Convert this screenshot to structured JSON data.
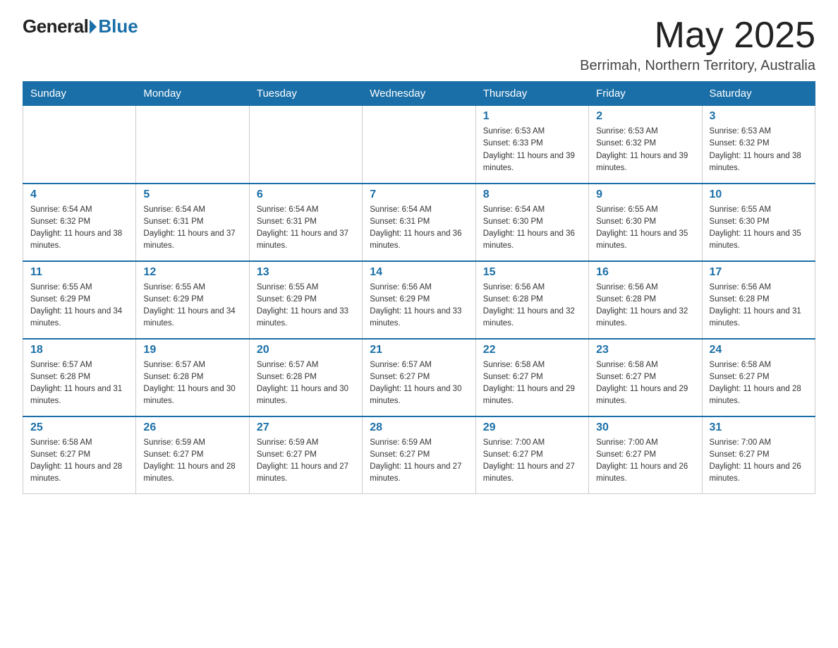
{
  "header": {
    "logo_general": "General",
    "logo_blue": "Blue",
    "month_year": "May 2025",
    "location": "Berrimah, Northern Territory, Australia"
  },
  "days_of_week": [
    "Sunday",
    "Monday",
    "Tuesday",
    "Wednesday",
    "Thursday",
    "Friday",
    "Saturday"
  ],
  "weeks": [
    [
      {
        "day": "",
        "info": ""
      },
      {
        "day": "",
        "info": ""
      },
      {
        "day": "",
        "info": ""
      },
      {
        "day": "",
        "info": ""
      },
      {
        "day": "1",
        "info": "Sunrise: 6:53 AM\nSunset: 6:33 PM\nDaylight: 11 hours and 39 minutes."
      },
      {
        "day": "2",
        "info": "Sunrise: 6:53 AM\nSunset: 6:32 PM\nDaylight: 11 hours and 39 minutes."
      },
      {
        "day": "3",
        "info": "Sunrise: 6:53 AM\nSunset: 6:32 PM\nDaylight: 11 hours and 38 minutes."
      }
    ],
    [
      {
        "day": "4",
        "info": "Sunrise: 6:54 AM\nSunset: 6:32 PM\nDaylight: 11 hours and 38 minutes."
      },
      {
        "day": "5",
        "info": "Sunrise: 6:54 AM\nSunset: 6:31 PM\nDaylight: 11 hours and 37 minutes."
      },
      {
        "day": "6",
        "info": "Sunrise: 6:54 AM\nSunset: 6:31 PM\nDaylight: 11 hours and 37 minutes."
      },
      {
        "day": "7",
        "info": "Sunrise: 6:54 AM\nSunset: 6:31 PM\nDaylight: 11 hours and 36 minutes."
      },
      {
        "day": "8",
        "info": "Sunrise: 6:54 AM\nSunset: 6:30 PM\nDaylight: 11 hours and 36 minutes."
      },
      {
        "day": "9",
        "info": "Sunrise: 6:55 AM\nSunset: 6:30 PM\nDaylight: 11 hours and 35 minutes."
      },
      {
        "day": "10",
        "info": "Sunrise: 6:55 AM\nSunset: 6:30 PM\nDaylight: 11 hours and 35 minutes."
      }
    ],
    [
      {
        "day": "11",
        "info": "Sunrise: 6:55 AM\nSunset: 6:29 PM\nDaylight: 11 hours and 34 minutes."
      },
      {
        "day": "12",
        "info": "Sunrise: 6:55 AM\nSunset: 6:29 PM\nDaylight: 11 hours and 34 minutes."
      },
      {
        "day": "13",
        "info": "Sunrise: 6:55 AM\nSunset: 6:29 PM\nDaylight: 11 hours and 33 minutes."
      },
      {
        "day": "14",
        "info": "Sunrise: 6:56 AM\nSunset: 6:29 PM\nDaylight: 11 hours and 33 minutes."
      },
      {
        "day": "15",
        "info": "Sunrise: 6:56 AM\nSunset: 6:28 PM\nDaylight: 11 hours and 32 minutes."
      },
      {
        "day": "16",
        "info": "Sunrise: 6:56 AM\nSunset: 6:28 PM\nDaylight: 11 hours and 32 minutes."
      },
      {
        "day": "17",
        "info": "Sunrise: 6:56 AM\nSunset: 6:28 PM\nDaylight: 11 hours and 31 minutes."
      }
    ],
    [
      {
        "day": "18",
        "info": "Sunrise: 6:57 AM\nSunset: 6:28 PM\nDaylight: 11 hours and 31 minutes."
      },
      {
        "day": "19",
        "info": "Sunrise: 6:57 AM\nSunset: 6:28 PM\nDaylight: 11 hours and 30 minutes."
      },
      {
        "day": "20",
        "info": "Sunrise: 6:57 AM\nSunset: 6:28 PM\nDaylight: 11 hours and 30 minutes."
      },
      {
        "day": "21",
        "info": "Sunrise: 6:57 AM\nSunset: 6:27 PM\nDaylight: 11 hours and 30 minutes."
      },
      {
        "day": "22",
        "info": "Sunrise: 6:58 AM\nSunset: 6:27 PM\nDaylight: 11 hours and 29 minutes."
      },
      {
        "day": "23",
        "info": "Sunrise: 6:58 AM\nSunset: 6:27 PM\nDaylight: 11 hours and 29 minutes."
      },
      {
        "day": "24",
        "info": "Sunrise: 6:58 AM\nSunset: 6:27 PM\nDaylight: 11 hours and 28 minutes."
      }
    ],
    [
      {
        "day": "25",
        "info": "Sunrise: 6:58 AM\nSunset: 6:27 PM\nDaylight: 11 hours and 28 minutes."
      },
      {
        "day": "26",
        "info": "Sunrise: 6:59 AM\nSunset: 6:27 PM\nDaylight: 11 hours and 28 minutes."
      },
      {
        "day": "27",
        "info": "Sunrise: 6:59 AM\nSunset: 6:27 PM\nDaylight: 11 hours and 27 minutes."
      },
      {
        "day": "28",
        "info": "Sunrise: 6:59 AM\nSunset: 6:27 PM\nDaylight: 11 hours and 27 minutes."
      },
      {
        "day": "29",
        "info": "Sunrise: 7:00 AM\nSunset: 6:27 PM\nDaylight: 11 hours and 27 minutes."
      },
      {
        "day": "30",
        "info": "Sunrise: 7:00 AM\nSunset: 6:27 PM\nDaylight: 11 hours and 26 minutes."
      },
      {
        "day": "31",
        "info": "Sunrise: 7:00 AM\nSunset: 6:27 PM\nDaylight: 11 hours and 26 minutes."
      }
    ]
  ]
}
